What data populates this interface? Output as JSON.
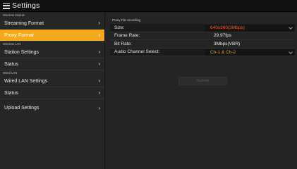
{
  "window": {
    "title": "Settings"
  },
  "sidebar": {
    "sections": [
      {
        "label": "Wireless Module",
        "items": [
          {
            "label": "Streaming Format",
            "active": false
          },
          {
            "label": "Proxy Format",
            "active": true
          }
        ]
      },
      {
        "label": "Wireless LAN",
        "items": [
          {
            "label": "Station Settings",
            "active": false
          },
          {
            "label": "Status",
            "active": false
          }
        ]
      },
      {
        "label": "Wired LAN",
        "items": [
          {
            "label": "Wired LAN Settings",
            "active": false
          },
          {
            "label": "Status",
            "active": false
          }
        ]
      }
    ],
    "extra_item": {
      "label": "Upload Settings"
    }
  },
  "content": {
    "section_title": "Proxy File recording",
    "fields": {
      "size": {
        "label": "Size:",
        "value": "640x360(3Mbps)"
      },
      "frame_rate": {
        "label": "Frame Rate:",
        "value": "29.97fps"
      },
      "bit_rate": {
        "label": "Bit Rate:",
        "value": "3Mbps(VBR)"
      },
      "audio_channel": {
        "label": "Audio Channel Select:",
        "value": "Ch-1 & Ch-2"
      }
    },
    "submit_label": "Submit"
  },
  "colors": {
    "accent": "#f3a91b",
    "select_text": "#f0a020",
    "background": "#242424"
  }
}
